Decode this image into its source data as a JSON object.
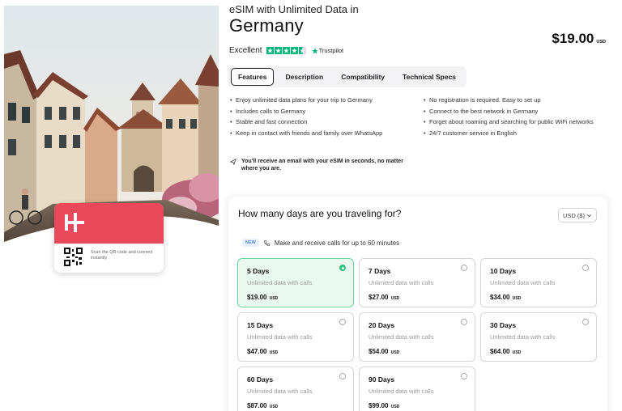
{
  "product": {
    "eyebrow": "eSIM with Unlimited Data in",
    "title": "Germany",
    "rating_word": "Excellent",
    "rating_stars": 4.5,
    "trustpilot_label": "Trustpilot",
    "price": "$19.00",
    "price_currency": "USD"
  },
  "card": {
    "scan_text": "Scan the QR code and connect instantly"
  },
  "tabs": [
    {
      "label": "Features",
      "active": true
    },
    {
      "label": "Description",
      "active": false
    },
    {
      "label": "Compatibility",
      "active": false
    },
    {
      "label": "Technical Specs",
      "active": false
    }
  ],
  "features": {
    "left": [
      "Enjoy unlimited data plans for your trip to Germany",
      "Includes calls to Germany",
      "Stable and fast connection",
      "Keep in contact with friends and family over WhatsApp"
    ],
    "right": [
      "No registration is required. Easy to set up",
      "Connect to the best network in Germany",
      "Forget about roaming and searching for public WiFi networks",
      "24/7 customer service in English"
    ],
    "email_note": "You'll receive an email with your eSIM in seconds, no matter where you are."
  },
  "plans_panel": {
    "question": "How many days are you traveling for?",
    "currency_selector": "USD ($)",
    "new_badge": "NEW",
    "calls_note": "Make and receive calls for up to 60 minutes",
    "plans": [
      {
        "days": "5 Days",
        "desc": "Unlimited data with calls",
        "price": "$19.00",
        "currency": "USD",
        "selected": true
      },
      {
        "days": "7 Days",
        "desc": "Unlimited data with calls",
        "price": "$27.00",
        "currency": "USD",
        "selected": false
      },
      {
        "days": "10 Days",
        "desc": "Unlimited data with calls",
        "price": "$34.00",
        "currency": "USD",
        "selected": false
      },
      {
        "days": "15 Days",
        "desc": "Unlimited data with calls",
        "price": "$47.00",
        "currency": "USD",
        "selected": false
      },
      {
        "days": "20 Days",
        "desc": "Unlimited data with calls",
        "price": "$54.00",
        "currency": "USD",
        "selected": false
      },
      {
        "days": "30 Days",
        "desc": "Unlimited data with calls",
        "price": "$64.00",
        "currency": "USD",
        "selected": false
      },
      {
        "days": "60 Days",
        "desc": "Unlimited data with calls",
        "price": "$87.00",
        "currency": "USD",
        "selected": false
      },
      {
        "days": "90 Days",
        "desc": "Unlimited data with calls",
        "price": "$99.00",
        "currency": "USD",
        "selected": false
      }
    ]
  },
  "colors": {
    "brand": "#e8495a",
    "selected_bg": "#e9f9f0",
    "selected_radio": "#2ec27e",
    "trustpilot_green": "#00b67a"
  },
  "icons": {
    "verified": "trustpilot-star-icon",
    "email": "paper-plane-icon",
    "phone": "phone-icon",
    "dropdown": "chevron-down-icon"
  }
}
